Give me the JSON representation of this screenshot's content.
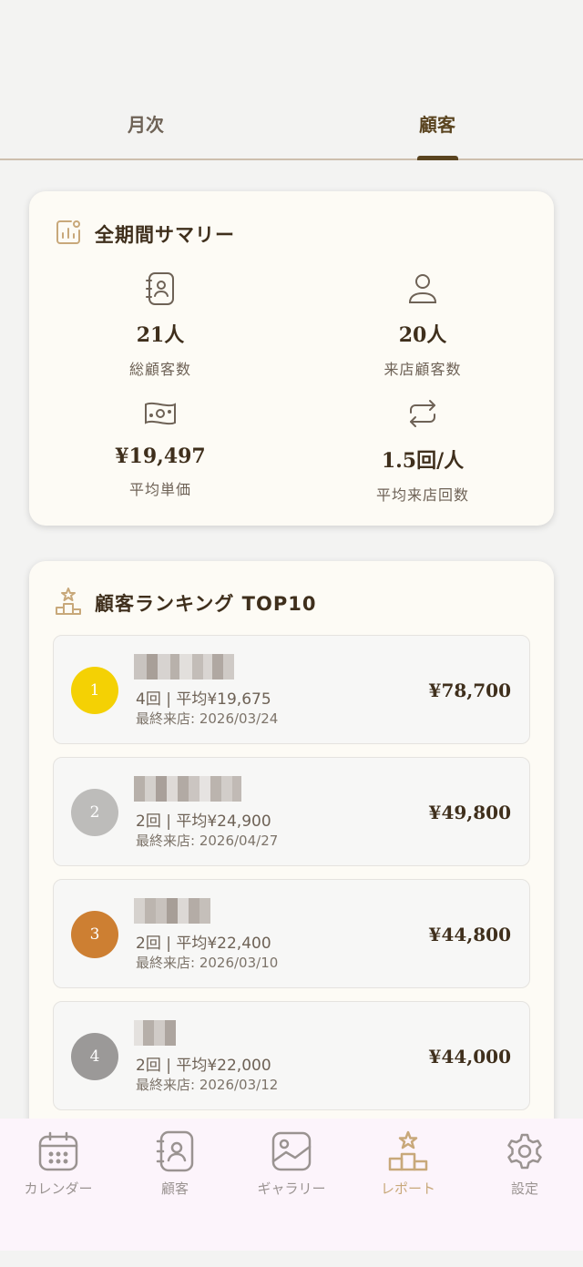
{
  "tabs": [
    {
      "label": "月次",
      "active": false
    },
    {
      "label": "顧客",
      "active": true
    }
  ],
  "summary": {
    "title": "全期間サマリー",
    "icon": "chart-report-icon",
    "stats": [
      {
        "icon": "contact-book-icon",
        "value": "21人",
        "label": "総顧客数"
      },
      {
        "icon": "person-icon",
        "value": "20人",
        "label": "来店顧客数"
      },
      {
        "icon": "money-bill-icon",
        "value": "¥19,497",
        "label": "平均単価"
      },
      {
        "icon": "repeat-icon",
        "value": "1.5回/人",
        "label": "平均来店回数"
      }
    ]
  },
  "ranking": {
    "title": "顧客ランキング TOP10",
    "icon": "podium-icon",
    "rows": [
      {
        "rank": "1",
        "medal_color": "#f4d104",
        "stats": "4回 | 平均¥19,675",
        "last_visit": "最終来店: 2026/03/24",
        "total": "¥78,700"
      },
      {
        "rank": "2",
        "medal_color": "#bdbcba",
        "stats": "2回 | 平均¥24,900",
        "last_visit": "最終来店: 2026/04/27",
        "total": "¥49,800"
      },
      {
        "rank": "3",
        "medal_color": "#cd7f32",
        "stats": "2回 | 平均¥22,400",
        "last_visit": "最終来店: 2026/03/10",
        "total": "¥44,800"
      },
      {
        "rank": "4",
        "medal_color": "#9b9998",
        "stats": "2回 | 平均¥22,000",
        "last_visit": "最終来店: 2026/03/12",
        "total": "¥44,000"
      }
    ]
  },
  "nav": [
    {
      "label": "カレンダー",
      "icon": "calendar-icon",
      "active": false
    },
    {
      "label": "顧客",
      "icon": "contacts-icon",
      "active": false
    },
    {
      "label": "ギャラリー",
      "icon": "gallery-icon",
      "active": false
    },
    {
      "label": "レポート",
      "icon": "report-podium-icon",
      "active": true
    },
    {
      "label": "設定",
      "icon": "gear-icon",
      "active": false
    }
  ],
  "colors": {
    "accent": "#5a4420",
    "nav_active": "#c8a87a",
    "nav_inactive": "#9a9391"
  }
}
